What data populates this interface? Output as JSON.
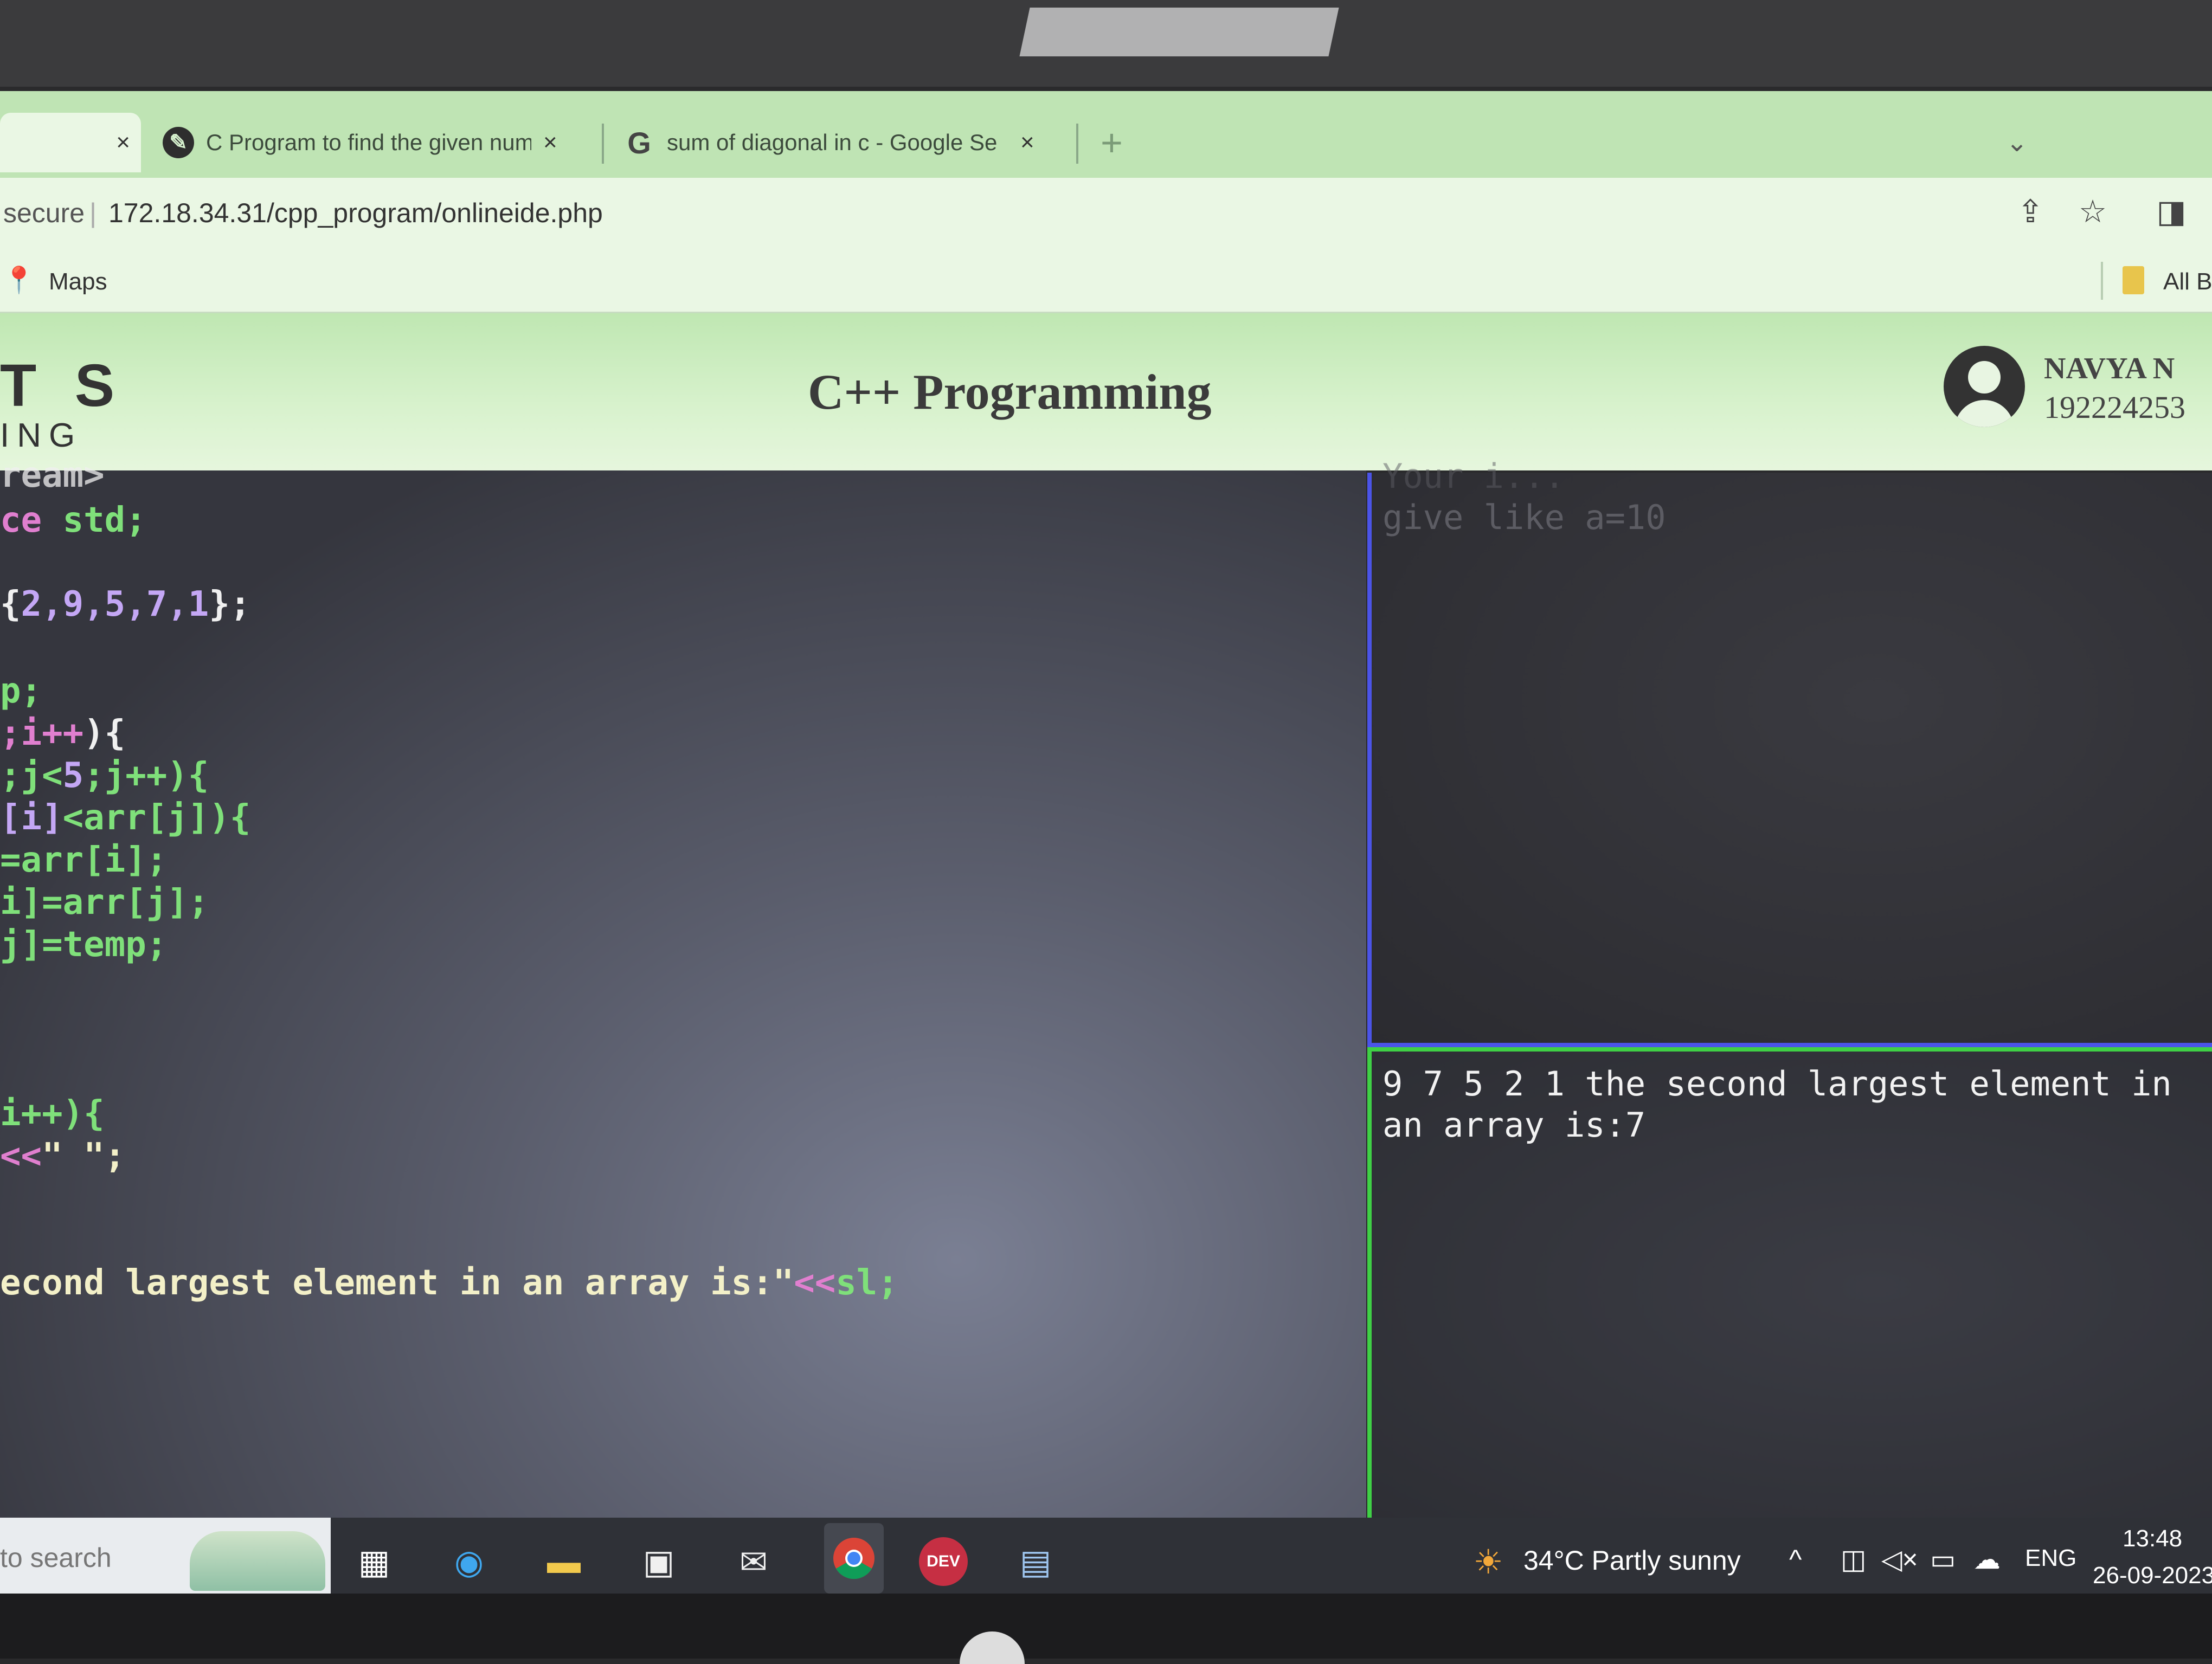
{
  "browser": {
    "tabs": [
      {
        "title": "",
        "close": "×",
        "active": true
      },
      {
        "title": "C Program to find the given num",
        "close": "×",
        "icon": "code-site-icon",
        "active": false
      },
      {
        "title": "sum of diagonal in c - Google Se",
        "close": "×",
        "icon": "google-icon",
        "active": false
      }
    ],
    "new_tab": "+",
    "tab_list_icon": "chevron-down-icon",
    "security_label": "secure",
    "url": "172.18.34.31/cpp_program/onlineide.php",
    "bookmarks": [
      {
        "label": "Maps",
        "icon": "maps-icon"
      }
    ],
    "all_bookmarks_label": "All B"
  },
  "site": {
    "brand_top": "T S",
    "brand_bottom": "ING",
    "title": "C++ Programming",
    "user_name": "NAVYA N",
    "user_id": "192224253"
  },
  "editor": {
    "line_0": "ream>",
    "line_1_a": "ce",
    "line_1_b": " std;",
    "line_2_a": "{",
    "line_2_b": "2,9,5,7,1",
    "line_2_c": "};",
    "line_3": "p;",
    "line_4_a": ";i++",
    "line_4_b": "){",
    "line_5_a": ";j<",
    "line_5_b": "5",
    "line_5_c": ";j++){",
    "line_6_a": "[i]",
    "line_6_b": "<arr[j]){",
    "line_7": "=arr[i];",
    "line_8": "i]=arr[j];",
    "line_9": "j]=temp;",
    "line_10": "i++){",
    "line_11_a": "<<",
    "line_11_b": "\" \";",
    "line_12_a": "econd largest element in an array is:\"",
    "line_12_b": "<<",
    "line_12_c": "sl;"
  },
  "input": {
    "hint_line1": "Your i...",
    "hint_line2": "give like a=10"
  },
  "output": {
    "text": "9 7 5 2 1 the second largest element in an array is:7"
  },
  "taskbar": {
    "search_placeholder": "to search",
    "apps": [
      "task-view-icon",
      "edge-icon",
      "file-explorer-icon",
      "store-icon",
      "mail-icon",
      "chrome-icon",
      "devcpp-icon",
      "app-icon"
    ],
    "weather": "34°C  Partly sunny",
    "language": "ENG",
    "time": "13:48",
    "date": "26-09-2023",
    "accent": "#7db8f0"
  },
  "colors": {
    "theme_green": "#bfe4b4",
    "input_border": "#4b54e8",
    "output_border": "#3fd046"
  }
}
